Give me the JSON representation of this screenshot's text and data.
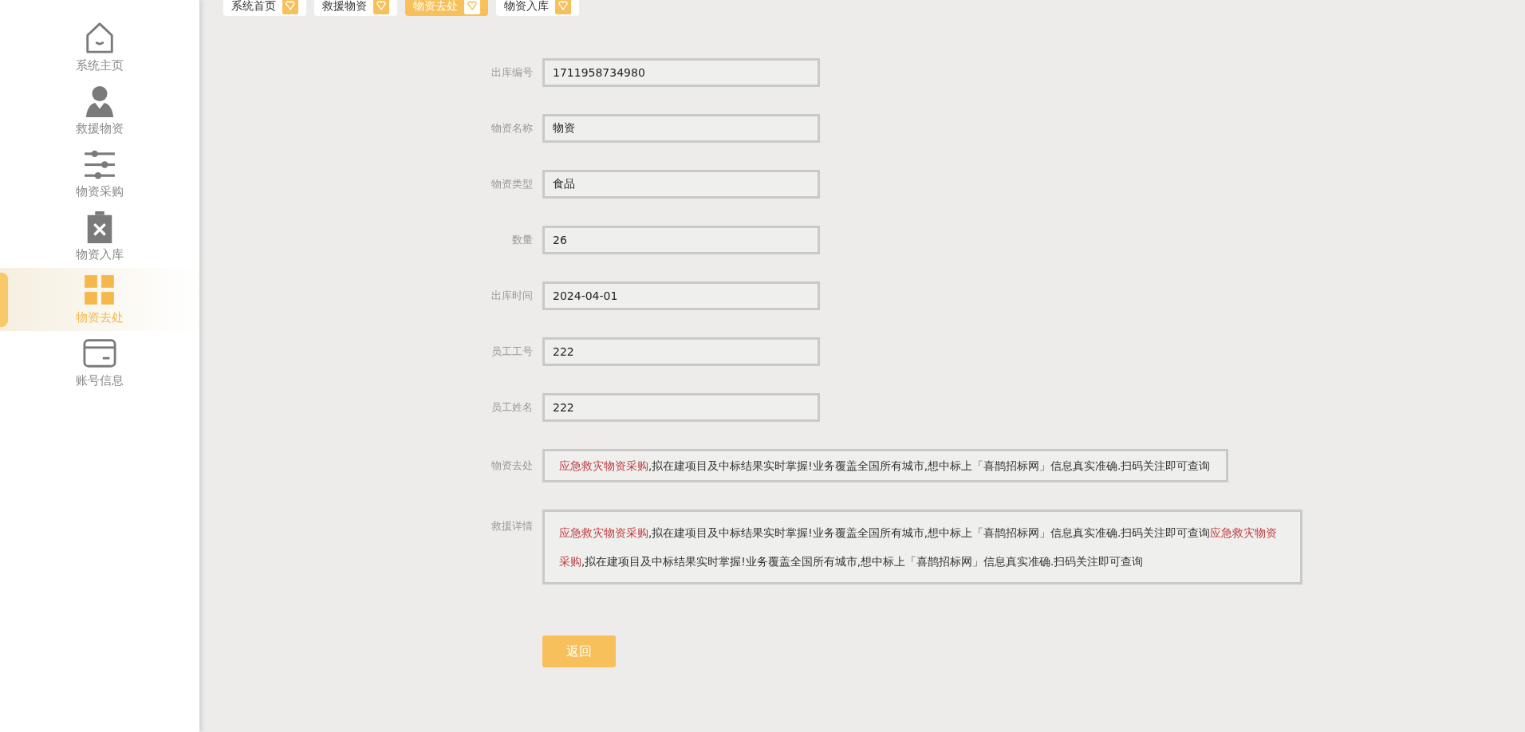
{
  "sidebar": {
    "items": [
      {
        "label": "系统主页",
        "kind": "home",
        "selected": false
      },
      {
        "label": "救援物资",
        "kind": "person",
        "selected": false
      },
      {
        "label": "物资采购",
        "kind": "sliders",
        "selected": false
      },
      {
        "label": "物资入库",
        "kind": "clipboard",
        "selected": false
      },
      {
        "label": "物资去处",
        "kind": "grid",
        "selected": true
      },
      {
        "label": "账号信息",
        "kind": "card",
        "selected": false
      }
    ]
  },
  "tabs": [
    {
      "label": "系统首页",
      "selected": false
    },
    {
      "label": "救援物资",
      "selected": false
    },
    {
      "label": "物资去处",
      "selected": true
    },
    {
      "label": "物资入库",
      "selected": false
    }
  ],
  "form": {
    "fields": [
      {
        "label": "出库编号",
        "value": "1711958734980"
      },
      {
        "label": "物资名称",
        "value": "物资"
      },
      {
        "label": "物资类型",
        "value": "食品"
      },
      {
        "label": "数量",
        "value": "26"
      },
      {
        "label": "出库时间",
        "value": "2024-04-01"
      },
      {
        "label": "员工工号",
        "value": "222"
      },
      {
        "label": "员工姓名",
        "value": "222"
      }
    ],
    "texts": [
      {
        "label": "物资去处",
        "kind": "short",
        "segments": [
          {
            "text": "应急救灾物资采购",
            "highlight": true
          },
          {
            "text": ",拟在建项目及中标结果实时掌握!业务覆盖全国所有城市,想中标上「喜鹊招标网」信息真实准确.扫码关注即可查询",
            "highlight": false
          }
        ]
      },
      {
        "label": "救援详情",
        "kind": "long",
        "segments": [
          {
            "text": "应急救灾物资采购",
            "highlight": true
          },
          {
            "text": ",拟在建项目及中标结果实时掌握!业务覆盖全国所有城市,想中标上「喜鹊招标网」信息真实准确.扫码关注即可查询",
            "highlight": false
          },
          {
            "text": "应急救灾物资采购",
            "highlight": true
          },
          {
            "text": ",拟在建项目及中标结果实时掌握!业务覆盖全国所有城市,想中标上「喜鹊招标网」信息真实准确.扫码关注即可查询",
            "highlight": false
          }
        ]
      }
    ],
    "button": "返回"
  }
}
